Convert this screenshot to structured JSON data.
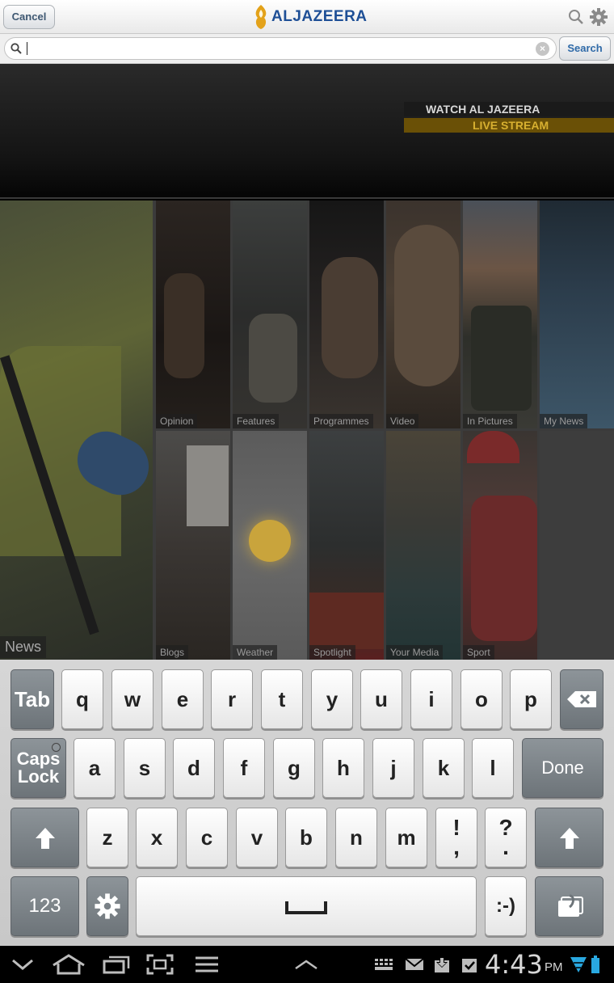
{
  "header": {
    "cancel_label": "Cancel",
    "brand_name": "ALJAZEERA",
    "brand_color": "#1e4f96"
  },
  "search": {
    "value": "",
    "placeholder": "",
    "button_label": "Search"
  },
  "banner": {
    "watch_text": "WATCH AL JAZEERA",
    "live_text": "LIVE STREAM"
  },
  "tiles": {
    "news": "News",
    "opinion": "Opinion",
    "features": "Features",
    "programmes": "Programmes",
    "video": "Video",
    "in_pictures": "In Pictures",
    "my_news": "My News",
    "blogs": "Blogs",
    "weather": "Weather",
    "spotlight": "Spotlight",
    "your_media": "Your Media",
    "sport": "Sport"
  },
  "keyboard": {
    "tab": "Tab",
    "row1": [
      "q",
      "w",
      "e",
      "r",
      "t",
      "y",
      "u",
      "i",
      "o",
      "p"
    ],
    "caps_line1": "Caps",
    "caps_line2": "Lock",
    "row2": [
      "a",
      "s",
      "d",
      "f",
      "g",
      "h",
      "j",
      "k",
      "l"
    ],
    "done": "Done",
    "row3": [
      "z",
      "x",
      "c",
      "v",
      "b",
      "n",
      "m"
    ],
    "excl_top": "!",
    "excl_bottom": ",",
    "quest_top": "?",
    "quest_bottom": ".",
    "numbers": "123",
    "smiley": ":-)",
    "icons": [
      "backspace-icon",
      "shift-icon",
      "settings-icon",
      "space-icon",
      "clipboard-icon"
    ]
  },
  "statusbar": {
    "time": "4:43",
    "ampm": "PM",
    "icons": [
      "back-icon",
      "home-icon",
      "recent-apps-icon",
      "screenshot-icon",
      "menu-icon",
      "up-icon",
      "keyboard-icon",
      "mail-icon",
      "download-icon",
      "clipboard-check-icon",
      "wifi-icon",
      "battery-icon"
    ]
  }
}
